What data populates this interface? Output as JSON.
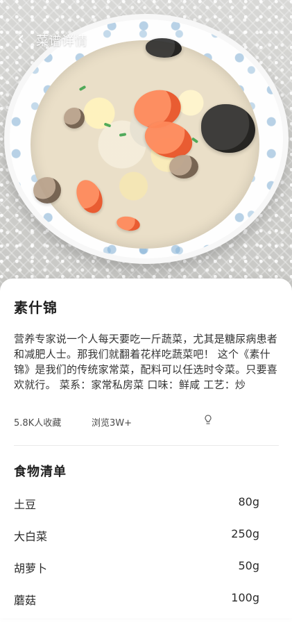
{
  "header": {
    "title": "菜谱详情"
  },
  "recipe": {
    "name": "素什锦",
    "description": "营养专家说一个人每天要吃一斤蔬菜，尤其是糖尿病患者和减肥人士。那我们就翻着花样吃蔬菜吧！ 这个《素什锦》是我们的传统家常菜，配料可以任选时令菜。只要喜欢就行。 菜系：家常私房菜 口味：鲜咸 工艺：炒"
  },
  "meta": {
    "favorites": "5.8K人收藏",
    "views": "浏览3W+"
  },
  "sections": {
    "food_list_title": "食物清单"
  },
  "ingredients": [
    {
      "name": "土豆",
      "amount": "80g"
    },
    {
      "name": "大白菜",
      "amount": "250g"
    },
    {
      "name": "胡萝卜",
      "amount": "50g"
    },
    {
      "name": "蘑菇",
      "amount": "100g"
    }
  ],
  "icons": {
    "back": "chevron-left-icon",
    "tip": "lightbulb-icon"
  }
}
